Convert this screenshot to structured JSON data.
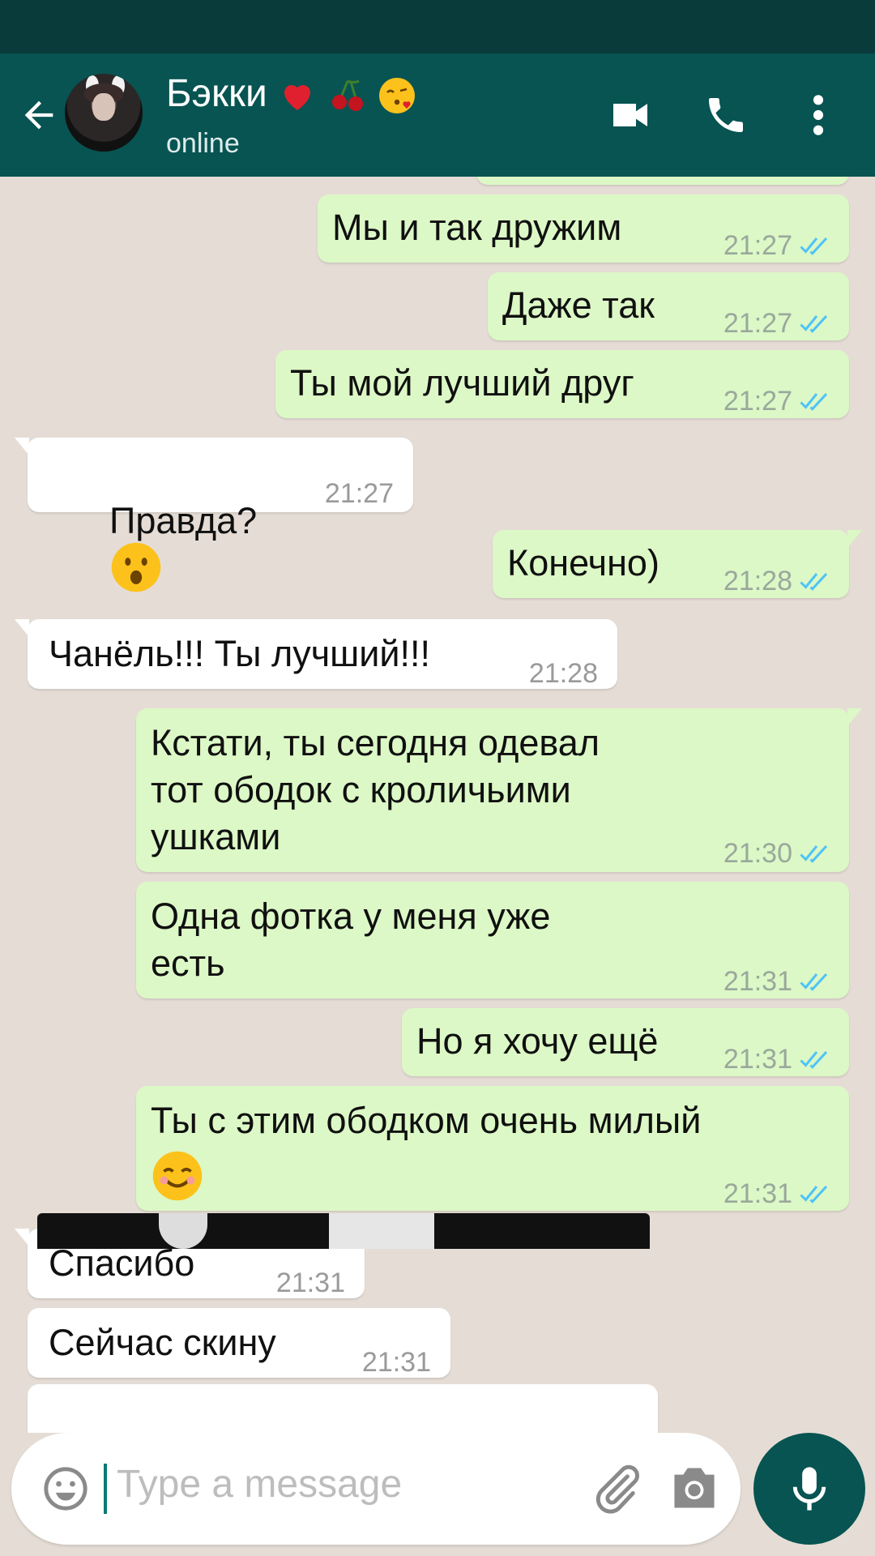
{
  "header": {
    "contact_name": "Бэкки",
    "contact_status": "online",
    "name_emojis": [
      "red-heart",
      "cherries",
      "face-blowing-kiss"
    ]
  },
  "messages": [
    {
      "dir": "out",
      "text": "Мы и так дружим",
      "time": "21:27",
      "ticks": "read"
    },
    {
      "dir": "out",
      "text": "Даже так",
      "time": "21:27",
      "ticks": "read"
    },
    {
      "dir": "out",
      "text": "Ты мой лучший друг",
      "time": "21:27",
      "ticks": "read"
    },
    {
      "dir": "in",
      "text": "Правда?",
      "emoji": "face-with-open-mouth",
      "time": "21:27"
    },
    {
      "dir": "out",
      "text": "Конечно)",
      "time": "21:28",
      "ticks": "read"
    },
    {
      "dir": "in",
      "text": "Чанёль!!! Ты лучший!!!",
      "time": "21:28"
    },
    {
      "dir": "out",
      "text": "Кстати, ты сегодня одевал\nтот ободок с кроличьими\nушками",
      "time": "21:30",
      "ticks": "read"
    },
    {
      "dir": "out",
      "text": "Одна фотка у меня уже\nесть",
      "time": "21:31",
      "ticks": "read"
    },
    {
      "dir": "out",
      "text": "Но я хочу ещё",
      "time": "21:31",
      "ticks": "read"
    },
    {
      "dir": "out",
      "text": "Ты с этим ободком очень милый",
      "emoji": "smiling-face-with-smiling-eyes",
      "time": "21:31",
      "ticks": "read"
    },
    {
      "dir": "in",
      "text": "Спасибо",
      "time": "21:31"
    },
    {
      "dir": "in",
      "text": "Сейчас скину",
      "time": "21:31"
    }
  ],
  "input": {
    "placeholder": "Type a message"
  },
  "colors": {
    "header": "#075452",
    "statusbar": "#083b3a",
    "outgoing": "#dcf8c6",
    "incoming": "#ffffff",
    "chat_bg": "#e5ddd5",
    "read_tick": "#4fc3f7"
  }
}
